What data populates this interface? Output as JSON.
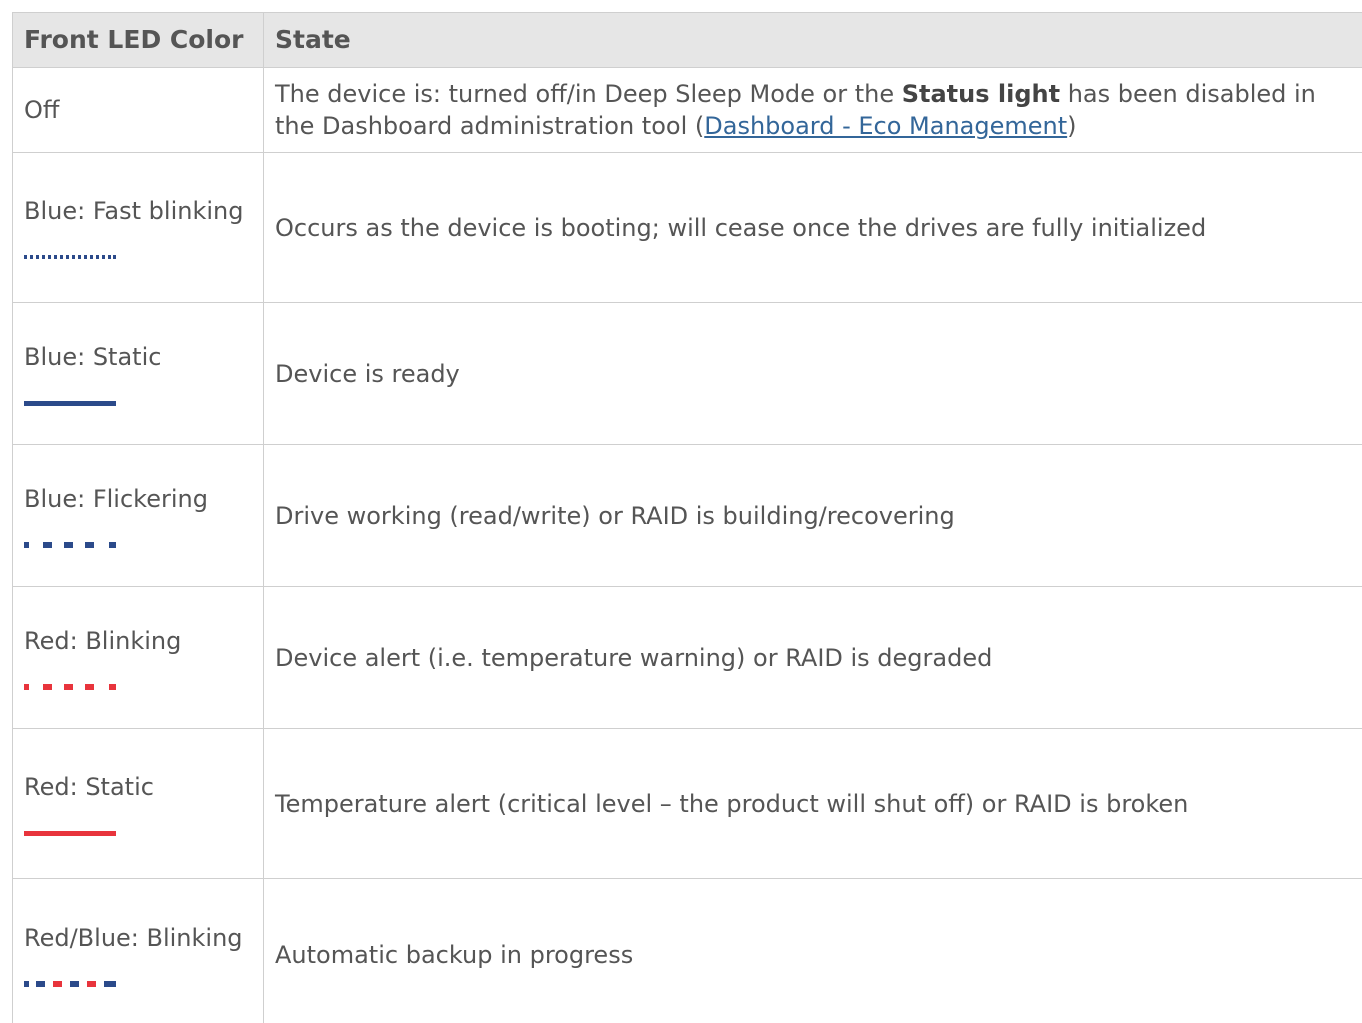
{
  "table": {
    "headers": {
      "color": "Front LED Color",
      "state": "State"
    },
    "rows": [
      {
        "color": "Off",
        "state_pre": "The device is: turned off/in Deep Sleep Mode or the ",
        "state_bold": "Status light",
        "state_mid": " has been disabled in the Dashboard administration tool (",
        "state_link": "Dashboard - Eco Management",
        "state_post": ")"
      },
      {
        "color": "Blue: Fast blinking",
        "icon": "blue-fast-blink-icon",
        "state": "Occurs as the device is booting; will cease once the drives are fully initialized"
      },
      {
        "color": "Blue: Static",
        "icon": "blue-static-icon",
        "state": "Device is ready"
      },
      {
        "color": "Blue: Flickering",
        "icon": "blue-flicker-icon",
        "state": "Drive working (read/write) or RAID is building/recovering"
      },
      {
        "color": "Red: Blinking",
        "icon": "red-blink-icon",
        "state": "Device alert (i.e. temperature warning) or RAID is degraded"
      },
      {
        "color": "Red: Static",
        "icon": "red-static-icon",
        "state": "Temperature alert (critical level – the product will shut off) or RAID is broken"
      },
      {
        "color": "Red/Blue: Blinking",
        "icon": "red-blue-blink-icon",
        "state": "Automatic backup in progress"
      }
    ]
  },
  "colors": {
    "blue": "#2b4a8a",
    "red": "#e8343c",
    "link": "#336699",
    "header_bg": "#e6e6e6",
    "border": "#cfcfcf"
  }
}
